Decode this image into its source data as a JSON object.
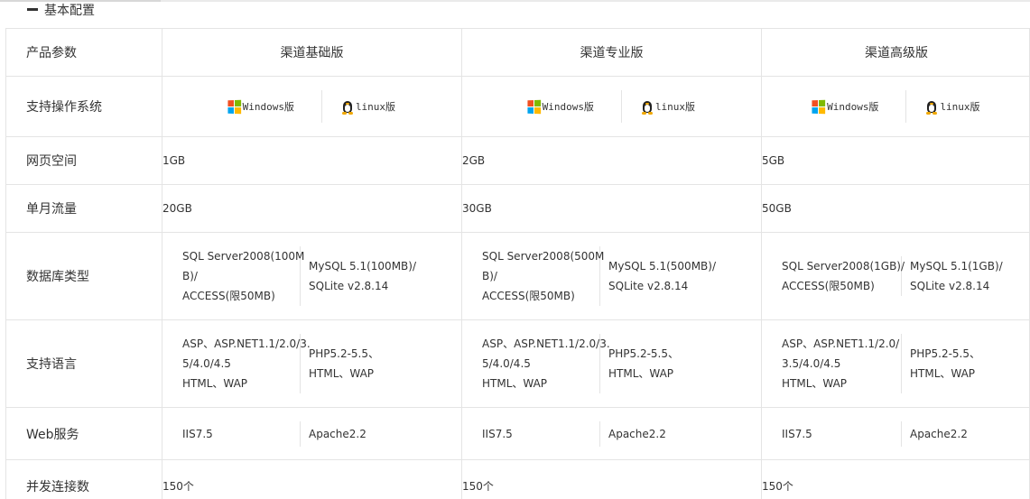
{
  "section": {
    "title": "基本配置"
  },
  "table": {
    "header_label": "产品参数",
    "columns": [
      "渠道基础版",
      "渠道专业版",
      "渠道高级版"
    ],
    "os_label": "支持操作系统",
    "os": {
      "windows": "Windows版",
      "linux": "linux版"
    },
    "space_label": "网页空间",
    "space": [
      "1GB",
      "2GB",
      "5GB"
    ],
    "flow_label": "单月流量",
    "flow": [
      "20GB",
      "30GB",
      "50GB"
    ],
    "db_label": "数据库类型",
    "db": [
      {
        "left": [
          "SQL Server2008(100M",
          "B)/",
          "ACCESS(限50MB)"
        ],
        "right": [
          "MySQL 5.1(100MB)/",
          "SQLite v2.8.14"
        ]
      },
      {
        "left": [
          "SQL Server2008(500M",
          "B)/",
          "ACCESS(限50MB)"
        ],
        "right": [
          "MySQL 5.1(500MB)/",
          "SQLite v2.8.14"
        ]
      },
      {
        "left": [
          "SQL Server2008(1GB)/",
          "ACCESS(限50MB)"
        ],
        "right": [
          "MySQL 5.1(1GB)/",
          "SQLite v2.8.14"
        ]
      }
    ],
    "lang_label": "支持语言",
    "lang": [
      {
        "left": [
          "ASP、ASP.NET1.1/2.0/3.",
          "5/4.0/4.5",
          "HTML、WAP"
        ],
        "right": [
          "PHP5.2-5.5、",
          "HTML、WAP"
        ]
      },
      {
        "left": [
          "ASP、ASP.NET1.1/2.0/3.",
          "5/4.0/4.5",
          "HTML、WAP"
        ],
        "right": [
          "PHP5.2-5.5、",
          "HTML、WAP"
        ]
      },
      {
        "left": [
          "ASP、ASP.NET1.1/2.0/",
          "3.5/4.0/4.5",
          "HTML、WAP"
        ],
        "right": [
          "PHP5.2-5.5、",
          "HTML、WAP"
        ]
      }
    ],
    "web_label": "Web服务",
    "web": [
      {
        "left": "IIS7.5",
        "right": "Apache2.2"
      },
      {
        "left": "IIS7.5",
        "right": "Apache2.2"
      },
      {
        "left": "IIS7.5",
        "right": "Apache2.2"
      }
    ],
    "conn_label": "并发连接数",
    "conn": [
      "150个",
      "150个",
      "150个"
    ]
  },
  "icons": {
    "windows": "windows-logo-icon",
    "linux": "linux-tux-icon",
    "section": "collapse-dash-icon"
  },
  "colors": {
    "border": "#e4e4e4",
    "text": "#333333",
    "windows_red": "#f25022",
    "windows_green": "#7fba00",
    "windows_blue": "#00a4ef",
    "windows_yellow": "#ffb900"
  }
}
